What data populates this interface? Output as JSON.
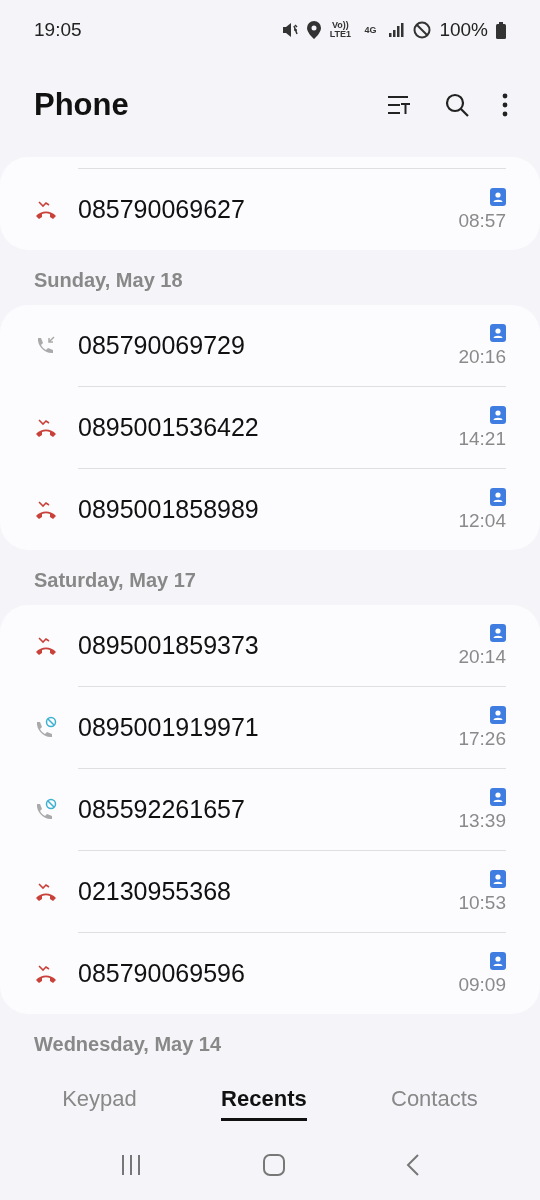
{
  "status_bar": {
    "time": "19:05",
    "volte": "Vo)) LTE1",
    "network": "4G",
    "battery": "100%"
  },
  "header": {
    "title": "Phone"
  },
  "groups": [
    {
      "calls": [
        {
          "number": "085790069627",
          "time": "08:57",
          "kind": "missed"
        }
      ]
    },
    {
      "date": "Sunday, May 18",
      "calls": [
        {
          "number": "085790069729",
          "time": "20:16",
          "kind": "incoming"
        },
        {
          "number": "0895001536422",
          "time": "14:21",
          "kind": "missed"
        },
        {
          "number": "0895001858989",
          "time": "12:04",
          "kind": "missed"
        }
      ]
    },
    {
      "date": "Saturday, May 17",
      "calls": [
        {
          "number": "0895001859373",
          "time": "20:14",
          "kind": "missed"
        },
        {
          "number": "0895001919971",
          "time": "17:26",
          "kind": "blocked"
        },
        {
          "number": "085592261657",
          "time": "13:39",
          "kind": "blocked"
        },
        {
          "number": "02130955368",
          "time": "10:53",
          "kind": "missed"
        },
        {
          "number": "085790069596",
          "time": "09:09",
          "kind": "missed"
        }
      ]
    },
    {
      "date": "Wednesday, May 14"
    }
  ],
  "tabs": [
    {
      "label": "Keypad",
      "selected": false
    },
    {
      "label": "Recents",
      "selected": true
    },
    {
      "label": "Contacts",
      "selected": false
    }
  ]
}
